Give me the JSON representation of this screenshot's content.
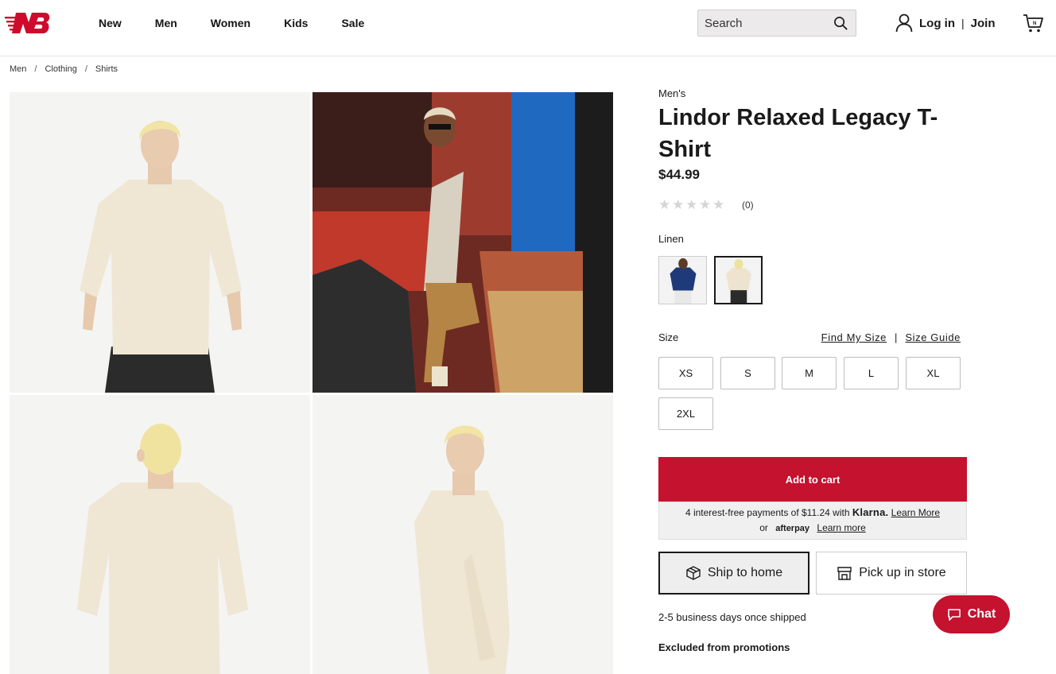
{
  "header": {
    "logo_alt": "NB",
    "nav": [
      "New",
      "Men",
      "Women",
      "Kids",
      "Sale"
    ],
    "search_placeholder": "Search",
    "login": "Log in",
    "join": "Join"
  },
  "breadcrumb": [
    "Men",
    "Clothing",
    "Shirts"
  ],
  "product": {
    "gender": "Men's",
    "title": "Lindor Relaxed Legacy T-Shirt",
    "price": "$44.99",
    "rating_count": "(0)",
    "rating_value": 0,
    "color_name": "Linen",
    "size_label": "Size",
    "find_my_size": "Find My Size",
    "size_guide": "Size Guide",
    "sizes": [
      "XS",
      "S",
      "M",
      "L",
      "XL",
      "2XL"
    ],
    "add_to_cart": "Add to cart",
    "pay_text": "4 interest-free payments of $11.24 with",
    "klarna": "Klarna.",
    "klarna_learn": "Learn More",
    "or": "or",
    "afterpay": "afterpay",
    "afterpay_learn": "Learn more",
    "ship_to_home": "Ship to home",
    "pick_up": "Pick up in store",
    "delivery": "2-5 business days once shipped",
    "excluded": "Excluded from promotions"
  },
  "chat": "Chat",
  "colors": {
    "brand_red": "#c4122f"
  }
}
